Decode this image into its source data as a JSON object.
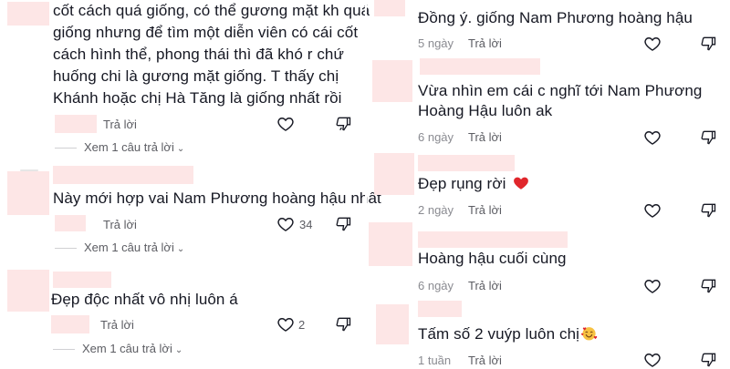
{
  "icons": {
    "like": "heart-outline-icon",
    "dislike": "thumbs-down-outline-icon",
    "emoji_red_heart": "red-heart-icon",
    "emoji_smiling_hearts": "smiling-face-with-hearts-icon"
  },
  "left": {
    "c1": {
      "lines": [
        "cốt cách quá giống, có thể gương mặt kh quá",
        "giống nhưng để tìm một diễn viên có cái cốt",
        "cách hình thể, phong thái thì đã khó r chứ",
        "huống chi là gương mặt giống. T thấy chị",
        "Khánh hoặc chị Hà Tăng là giống nhất rồi"
      ],
      "reply": "Trả lời",
      "view_replies": "Xem 1 câu trả lời"
    },
    "c2": {
      "text": "Này mới hợp vai Nam Phương hoàng hậu nhất",
      "reply": "Trả lời",
      "likes": "34",
      "view_replies": "Xem 1 câu trả lời"
    },
    "c3": {
      "text": "Đẹp độc nhất vô nhị luôn á",
      "reply": "Trả lời",
      "likes": "2",
      "view_replies": "Xem 1 câu trả lời"
    }
  },
  "right": {
    "r1": {
      "text": "Đồng ý. giống Nam Phương hoàng hậu",
      "time": "5 ngày",
      "reply": "Trả lời"
    },
    "r2": {
      "lines": [
        "Vừa nhìn em cái c nghĩ tới Nam Phương",
        "Hoàng Hậu luôn ak"
      ],
      "time": "6 ngày",
      "reply": "Trả lời"
    },
    "r3": {
      "text": "Đẹp rụng rời ",
      "time": "2 ngày",
      "reply": "Trả lời"
    },
    "r4": {
      "text": "Hoàng hậu cuối cùng",
      "time": "6 ngày",
      "reply": "Trả lời"
    },
    "r5": {
      "text": "Tấm số 2 vuýp luôn chị",
      "time": "1 tuần",
      "reply": "Trả lời"
    }
  },
  "colors": {
    "text": "#161823",
    "meta": "#8a8b91",
    "redaction": "#fde6e6",
    "heart_red": "#e0262b"
  }
}
